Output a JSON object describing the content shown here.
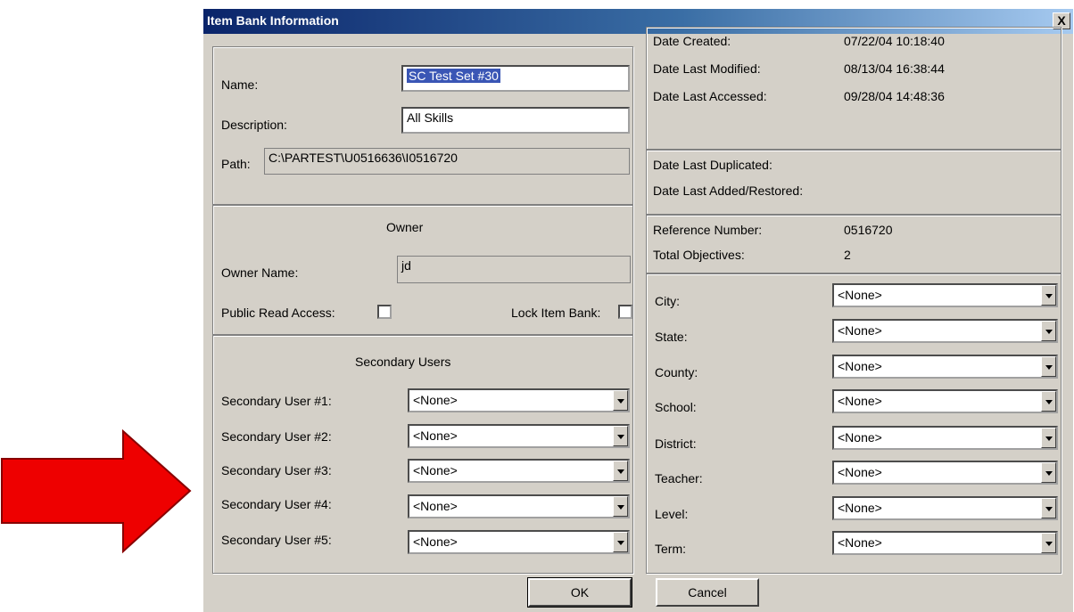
{
  "window": {
    "title": "Item Bank Information",
    "close_glyph": "X"
  },
  "general": {
    "name_label": "Name:",
    "name_value": "SC Test Set #30",
    "description_label": "Description:",
    "description_value": "All Skills",
    "path_label": "Path:",
    "path_value": "C:\\PARTEST\\U0516636\\I0516720"
  },
  "owner": {
    "heading": "Owner",
    "owner_name_label": "Owner Name:",
    "owner_name_value": "jd",
    "public_read_label": "Public Read Access:",
    "lock_label": "Lock Item Bank:"
  },
  "secondary_users": {
    "heading": "Secondary Users",
    "items": [
      {
        "label": "Secondary User #1:",
        "value": "<None>"
      },
      {
        "label": "Secondary User #2:",
        "value": "<None>"
      },
      {
        "label": "Secondary User #3:",
        "value": "<None>"
      },
      {
        "label": "Secondary User #4:",
        "value": "<None>"
      },
      {
        "label": "Secondary User #5:",
        "value": "<None>"
      }
    ]
  },
  "dates": {
    "created_label": "Date Created:",
    "created_value": "07/22/04 10:18:40",
    "modified_label": "Date Last Modified:",
    "modified_value": "08/13/04 16:38:44",
    "accessed_label": "Date Last Accessed:",
    "accessed_value": "09/28/04 14:48:36",
    "duplicated_label": "Date Last Duplicated:",
    "added_restored_label": "Date Last Added/Restored:"
  },
  "reference": {
    "ref_label": "Reference Number:",
    "ref_value": "0516720",
    "objectives_label": "Total Objectives:",
    "objectives_value": "2"
  },
  "fields": [
    {
      "label": "City:",
      "value": "<None>"
    },
    {
      "label": "State:",
      "value": "<None>"
    },
    {
      "label": "County:",
      "value": "<None>"
    },
    {
      "label": "School:",
      "value": "<None>"
    },
    {
      "label": "District:",
      "value": "<None>"
    },
    {
      "label": "Teacher:",
      "value": "<None>"
    },
    {
      "label": "Level:",
      "value": "<None>"
    },
    {
      "label": "Term:",
      "value": "<None>"
    }
  ],
  "buttons": {
    "ok": "OK",
    "cancel": "Cancel"
  },
  "colors": {
    "arrow": "#ee0000",
    "titlebar_start": "#0a246a",
    "dialog_bg": "#d4d0c8"
  }
}
